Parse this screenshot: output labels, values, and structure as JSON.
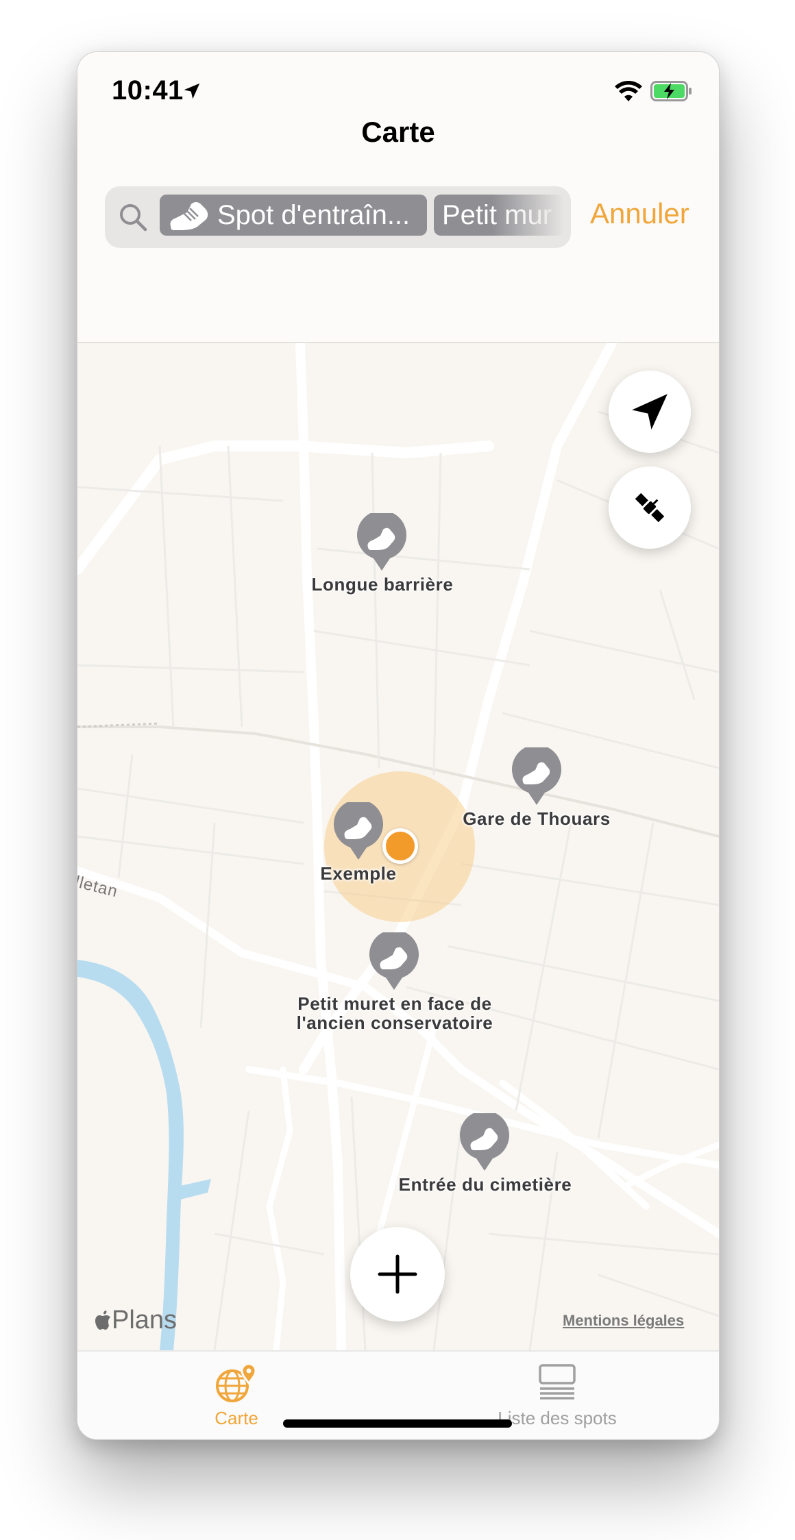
{
  "status_bar": {
    "time": "10:41",
    "icons": [
      "location-arrow-icon",
      "wifi-icon",
      "battery-charging-icon"
    ]
  },
  "nav": {
    "title": "Carte",
    "cancel_label": "Annuler"
  },
  "search": {
    "tokens": [
      {
        "label": "Spot d'entraîn...",
        "icon": "shoe-icon"
      },
      {
        "label": "Petit mur"
      }
    ]
  },
  "map": {
    "pins": [
      {
        "label": "Longue barrière"
      },
      {
        "label": "Gare de Thouars"
      },
      {
        "label": "Exemple"
      },
      {
        "label": "Petit muret en face de",
        "label2": "l'ancien conservatoire"
      },
      {
        "label": "Entrée du cimetière"
      }
    ],
    "street_label": "lletan",
    "brand": "Plans",
    "legal": "Mentions légales",
    "buttons": [
      "location-arrow-icon",
      "satellite-icon",
      "plus-icon"
    ]
  },
  "tabbar": {
    "tabs": [
      {
        "label": "Carte",
        "active": true
      },
      {
        "label": "Liste des spots",
        "active": false
      }
    ]
  },
  "colors": {
    "accent": "#f0a63a",
    "pin": "#8e8e93",
    "water": "#b8dcef"
  }
}
